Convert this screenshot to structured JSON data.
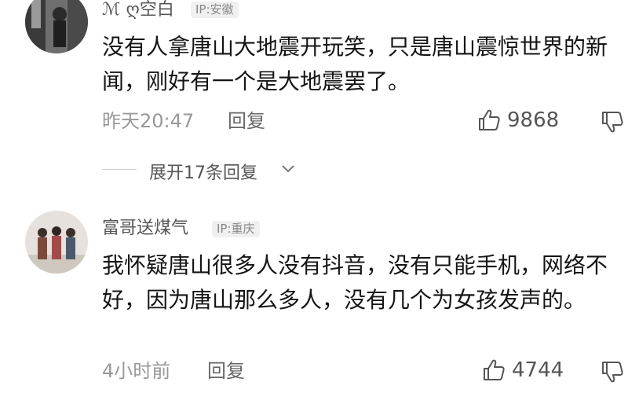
{
  "comments": [
    {
      "username": "ℳ ღ空白",
      "ip": "IP:安徽",
      "text": "没有人拿唐山大地震开玩笑，只是唐山震惊世界的新闻，刚好有一个是大地震罢了。",
      "time": "昨天20:47",
      "reply_label": "回复",
      "likes": "9868",
      "expand_label": "展开17条回复"
    },
    {
      "username": "富哥送煤气",
      "ip": "IP:重庆",
      "text": "我怀疑唐山很多人没有抖音，没有只能手机，网络不好，因为唐山那么多人，没有几个为女孩发声的。",
      "time": "4小时前",
      "reply_label": "回复",
      "likes": "4744"
    }
  ]
}
